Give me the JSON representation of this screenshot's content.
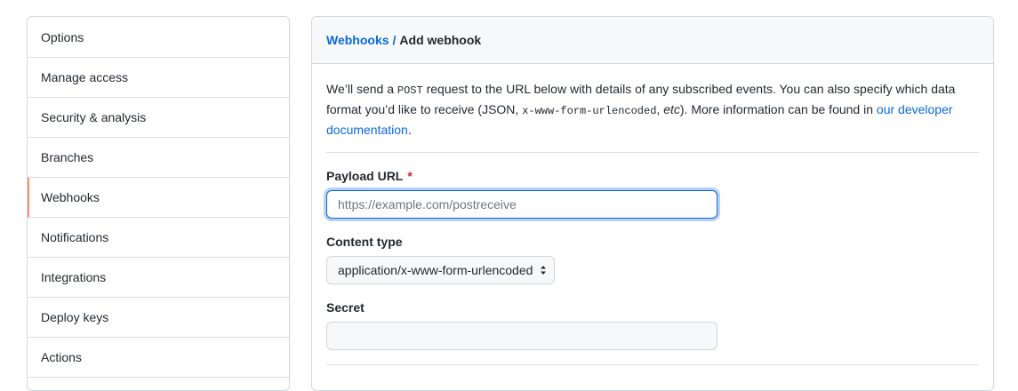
{
  "sidebar": {
    "items": [
      {
        "label": "Options"
      },
      {
        "label": "Manage access"
      },
      {
        "label": "Security & analysis"
      },
      {
        "label": "Branches"
      },
      {
        "label": "Webhooks",
        "selected": true
      },
      {
        "label": "Notifications"
      },
      {
        "label": "Integrations"
      },
      {
        "label": "Deploy keys"
      },
      {
        "label": "Actions"
      }
    ]
  },
  "header": {
    "crumb_link": "Webhooks",
    "crumb_sep": "/",
    "crumb_current": "Add webhook"
  },
  "intro": {
    "p1": "We’ll send a ",
    "code1": "POST",
    "p2": " request to the URL below with details of any subscribed events. You can also specify which data format you’d like to receive (JSON, ",
    "code2": "x-www-form-urlencoded",
    "p3": ", ",
    "em": "etc",
    "p4": "). More information can be found in ",
    "link": "our developer documentation",
    "p5": "."
  },
  "form": {
    "payload_label": "Payload URL",
    "required_mark": "*",
    "payload_value": "",
    "payload_placeholder": "https://example.com/postreceive",
    "content_type_label": "Content type",
    "content_type_value": "application/x-www-form-urlencoded",
    "secret_label": "Secret",
    "secret_value": ""
  },
  "colors": {
    "accent": "#0969da",
    "selected_marker": "#fd8c73",
    "required": "#cf222e"
  },
  "icons": {
    "select": "select-arrows-icon"
  }
}
